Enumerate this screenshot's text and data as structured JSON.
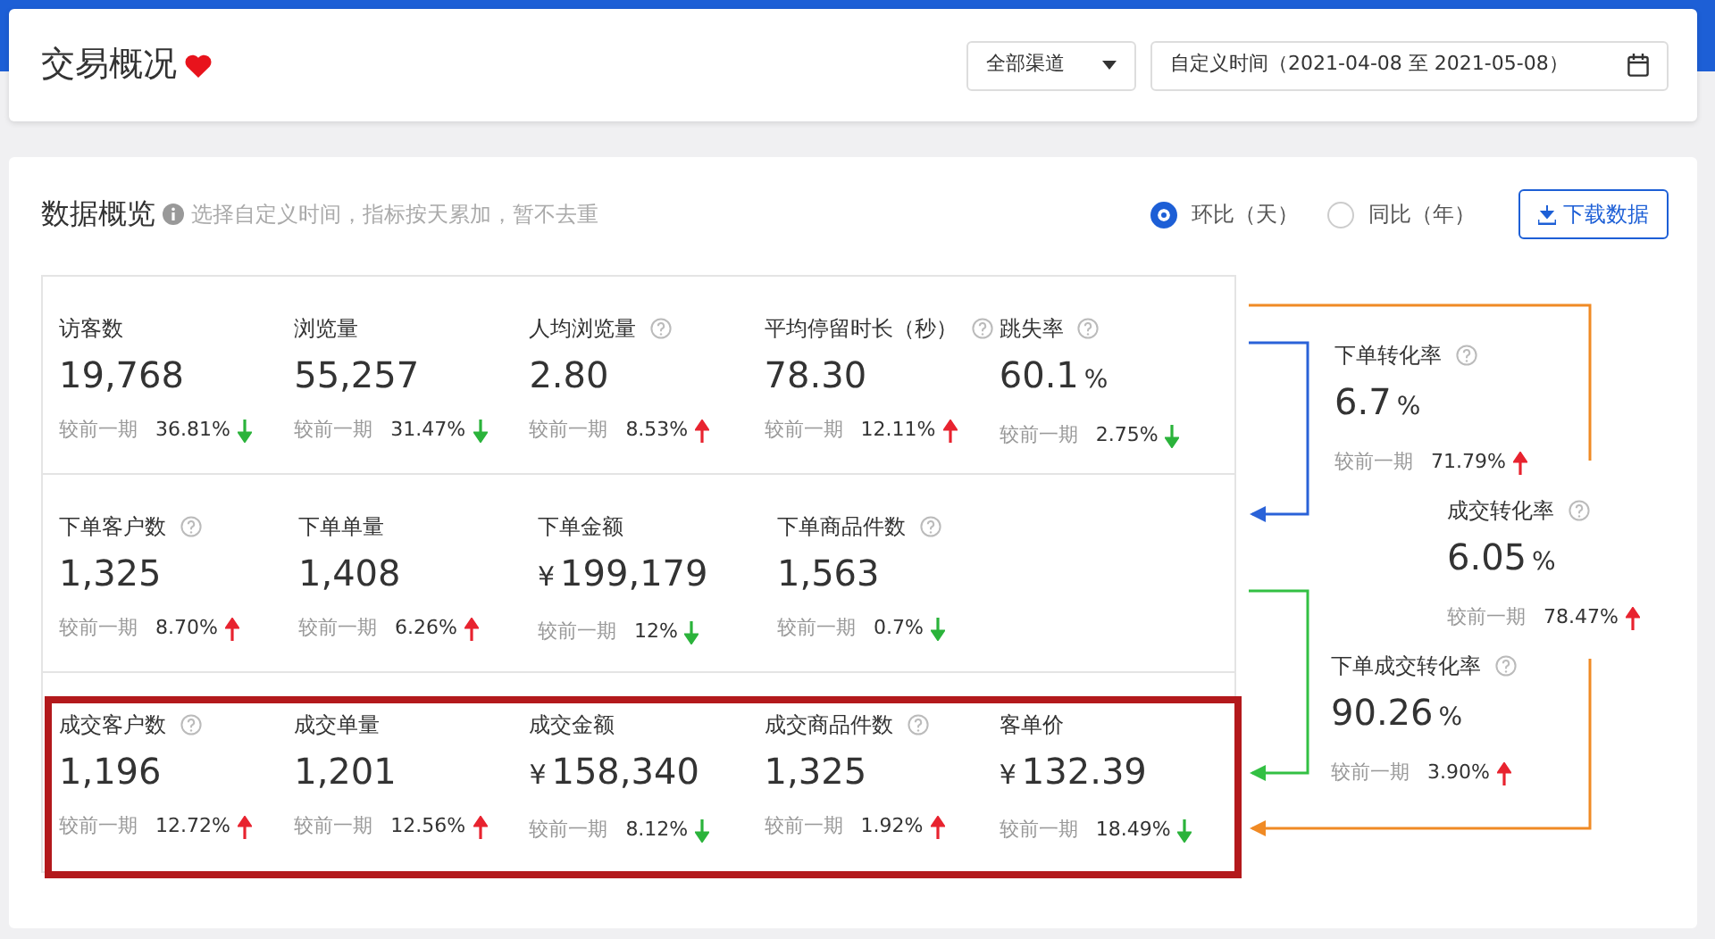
{
  "header": {
    "title": "交易概况",
    "channel_select": "全部渠道",
    "date_range": "自定义时间（2021-04-08 至 2021-05-08）"
  },
  "overview": {
    "title": "数据概览",
    "hint": "选择自定义时间，指标按天累加，暂不去重",
    "compare_options": [
      {
        "label": "环比（天）",
        "selected": true
      },
      {
        "label": "同比（年）",
        "selected": false
      }
    ],
    "download_button": "下载数据",
    "rows": [
      {
        "highlighted": false,
        "metrics": [
          {
            "label": "访客数",
            "help": false,
            "value": "19,768",
            "compare_label": "较前一期",
            "change": "36.81%",
            "up": false
          },
          {
            "label": "浏览量",
            "help": false,
            "value": "55,257",
            "compare_label": "较前一期",
            "change": "31.47%",
            "up": false
          },
          {
            "label": "人均浏览量",
            "help": true,
            "value": "2.80",
            "compare_label": "较前一期",
            "change": "8.53%",
            "up": true
          },
          {
            "label": "平均停留时长（秒）",
            "help": true,
            "value": "78.30",
            "compare_label": "较前一期",
            "change": "12.11%",
            "up": true
          },
          {
            "label": "跳失率",
            "help": true,
            "value": "60.1",
            "unit": "%",
            "compare_label": "较前一期",
            "change": "2.75%",
            "up": false
          }
        ]
      },
      {
        "highlighted": false,
        "metrics": [
          {
            "label": "下单客户数",
            "help": true,
            "value": "1,325",
            "compare_label": "较前一期",
            "change": "8.70%",
            "up": true
          },
          {
            "label": "下单单量",
            "help": false,
            "value": "1,408",
            "compare_label": "较前一期",
            "change": "6.26%",
            "up": true
          },
          {
            "label": "下单金额",
            "help": false,
            "prefix": "¥",
            "value": "199,179",
            "compare_label": "较前一期",
            "change": "12%",
            "up": false
          },
          {
            "label": "下单商品件数",
            "help": true,
            "value": "1,563",
            "compare_label": "较前一期",
            "change": "0.7%",
            "up": false
          }
        ]
      },
      {
        "highlighted": true,
        "metrics": [
          {
            "label": "成交客户数",
            "help": true,
            "value": "1,196",
            "compare_label": "较前一期",
            "change": "12.72%",
            "up": true
          },
          {
            "label": "成交单量",
            "help": false,
            "value": "1,201",
            "compare_label": "较前一期",
            "change": "12.56%",
            "up": true
          },
          {
            "label": "成交金额",
            "help": false,
            "prefix": "¥",
            "value": "158,340",
            "compare_label": "较前一期",
            "change": "8.12%",
            "up": false
          },
          {
            "label": "成交商品件数",
            "help": true,
            "value": "1,325",
            "compare_label": "较前一期",
            "change": "1.92%",
            "up": true
          },
          {
            "label": "客单价",
            "help": false,
            "prefix": "¥",
            "value": "132.39",
            "compare_label": "较前一期",
            "change": "18.49%",
            "up": false
          }
        ]
      }
    ],
    "rates": [
      {
        "label": "下单转化率",
        "help": true,
        "value": "6.7",
        "unit": "%",
        "compare_label": "较前一期",
        "change": "71.79%",
        "up": true
      },
      {
        "label": "成交转化率",
        "help": true,
        "value": "6.05",
        "unit": "%",
        "compare_label": "较前一期",
        "change": "78.47%",
        "up": true
      },
      {
        "label": "下单成交转化率",
        "help": true,
        "value": "90.26",
        "unit": "%",
        "compare_label": "较前一期",
        "change": "3.90%",
        "up": true
      }
    ]
  }
}
